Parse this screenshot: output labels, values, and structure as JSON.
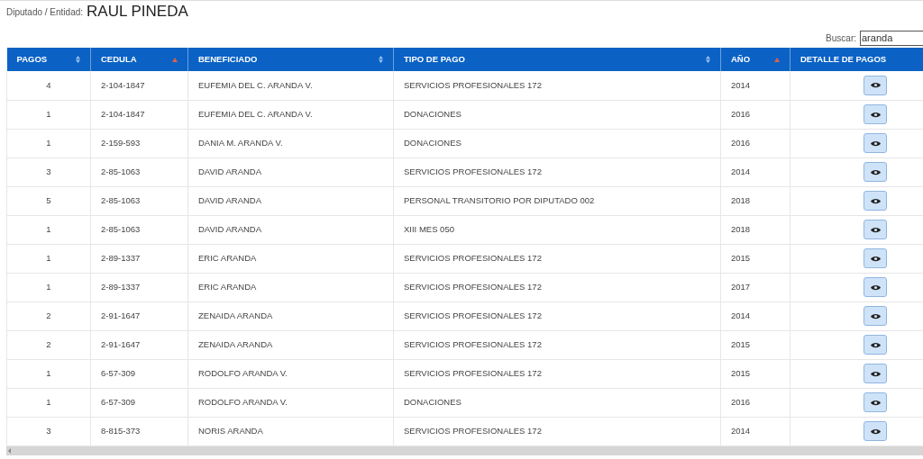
{
  "header": {
    "label": "Diputado / Entidad:",
    "name": "RAUL PINEDA"
  },
  "search": {
    "label": "Buscar:",
    "value": "aranda"
  },
  "table": {
    "columns": [
      {
        "label": "PAGOS",
        "sortable": true,
        "sorted": false
      },
      {
        "label": "CEDULA",
        "sortable": true,
        "sorted": true
      },
      {
        "label": "BENEFICIADO",
        "sortable": true,
        "sorted": false
      },
      {
        "label": "TIPO DE PAGO",
        "sortable": true,
        "sorted": false
      },
      {
        "label": "AÑO",
        "sortable": true,
        "sorted": true
      },
      {
        "label": "DETALLE DE PAGOS",
        "sortable": false
      }
    ],
    "rows": [
      [
        "4",
        "2-104-1847",
        "EUFEMIA DEL C. ARANDA V.",
        "SERVICIOS PROFESIONALES 172",
        "2014"
      ],
      [
        "1",
        "2-104-1847",
        "EUFEMIA DEL C. ARANDA V.",
        "DONACIONES",
        "2016"
      ],
      [
        "1",
        "2-159-593",
        "DANIA M. ARANDA V.",
        "DONACIONES",
        "2016"
      ],
      [
        "3",
        "2-85-1063",
        "DAVID ARANDA",
        "SERVICIOS PROFESIONALES 172",
        "2014"
      ],
      [
        "5",
        "2-85-1063",
        "DAVID ARANDA",
        "PERSONAL TRANSITORIO POR DIPUTADO 002",
        "2018"
      ],
      [
        "1",
        "2-85-1063",
        "DAVID ARANDA",
        "XIII MES 050",
        "2018"
      ],
      [
        "1",
        "2-89-1337",
        "ERIC ARANDA",
        "SERVICIOS PROFESIONALES 172",
        "2015"
      ],
      [
        "1",
        "2-89-1337",
        "ERIC ARANDA",
        "SERVICIOS PROFESIONALES 172",
        "2017"
      ],
      [
        "2",
        "2-91-1647",
        "ZENAIDA ARANDA",
        "SERVICIOS PROFESIONALES 172",
        "2014"
      ],
      [
        "2",
        "2-91-1647",
        "ZENAIDA ARANDA",
        "SERVICIOS PROFESIONALES 172",
        "2015"
      ],
      [
        "1",
        "6-57-309",
        "RODOLFO ARANDA V.",
        "SERVICIOS PROFESIONALES 172",
        "2015"
      ],
      [
        "1",
        "6-57-309",
        "RODOLFO ARANDA V.",
        "DONACIONES",
        "2016"
      ],
      [
        "3",
        "8-815-373",
        "NORIS ARANDA",
        "SERVICIOS PROFESIONALES 172",
        "2014"
      ]
    ]
  }
}
